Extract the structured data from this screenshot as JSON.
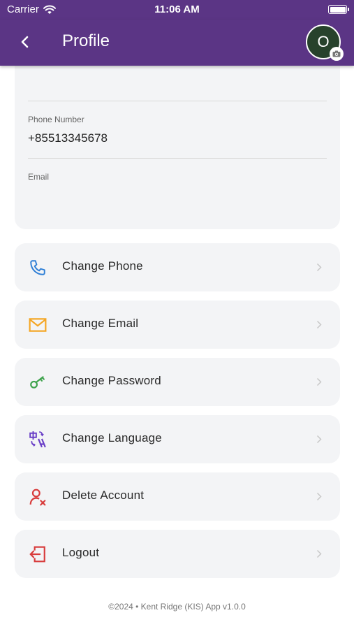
{
  "status_bar": {
    "carrier": "Carrier",
    "time": "11:06 AM"
  },
  "header": {
    "title": "Profile",
    "avatar_initial": "O",
    "accent_color": "#5b3585"
  },
  "profile": {
    "phone_label": "Phone Number",
    "phone_value": "+85513345678",
    "email_label": "Email",
    "email_value": ""
  },
  "menu": [
    {
      "label": "Change Phone",
      "icon": "phone-icon",
      "color": "#2f7fd6"
    },
    {
      "label": "Change Email",
      "icon": "email-icon",
      "color": "#f5a623"
    },
    {
      "label": "Change Password",
      "icon": "key-icon",
      "color": "#3fa34d"
    },
    {
      "label": "Change Language",
      "icon": "translate-icon",
      "color": "#6a3fc7"
    },
    {
      "label": "Delete Account",
      "icon": "delete-user-icon",
      "color": "#d83b3b"
    },
    {
      "label": "Logout",
      "icon": "logout-icon",
      "color": "#d83b3b"
    }
  ],
  "footer": {
    "text": "©2024 • Kent Ridge (KIS) App v1.0.0"
  }
}
